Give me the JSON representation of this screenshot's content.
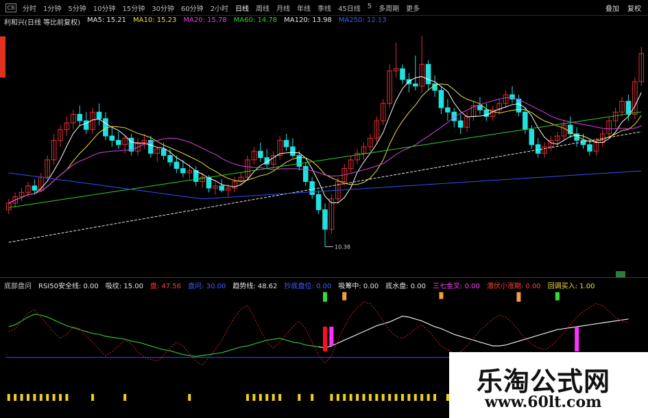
{
  "toolbar": {
    "window_badge": "CB",
    "tabs": [
      "分时",
      "1分钟",
      "5分钟",
      "10分钟",
      "15分钟",
      "30分钟",
      "60分钟",
      "2小时",
      "日线",
      "周线",
      "月线",
      "年线",
      "季线",
      "45日线",
      "5",
      "多周期",
      "更多"
    ],
    "active_tab": "日线",
    "right_buttons": [
      "叠加",
      "复权"
    ]
  },
  "main_legend": {
    "stock": "利和兴(日线 等比前复权)",
    "items": [
      {
        "label": "MA5: 15.21",
        "color": "#e8e8e8"
      },
      {
        "label": "MA10: 15.23",
        "color": "#f0e040"
      },
      {
        "label": "MA20: 15.78",
        "color": "#e040e0"
      },
      {
        "label": "MA60: 14.78",
        "color": "#30d030"
      },
      {
        "label": "MA120: 13.98",
        "color": "#e8e8e8"
      },
      {
        "label": "MA250: 12.13",
        "color": "#3060ff"
      }
    ]
  },
  "low_label": "10.38",
  "ind_legend": {
    "items": [
      {
        "label": "底部盘问",
        "color": "#c8c8c8"
      },
      {
        "label": "RSI50安全线: 0.00",
        "color": "#e8e8e8"
      },
      {
        "label": "吸纹: 15.00",
        "color": "#e8e8e8"
      },
      {
        "label": "盘: 47.56",
        "color": "#ff4040"
      },
      {
        "label": "盘问: 30.00",
        "color": "#4060ff"
      },
      {
        "label": "趋势线: 48.62",
        "color": "#e8e8e8"
      },
      {
        "label": "抄底盘位: 0.00",
        "color": "#4060ff"
      },
      {
        "label": "吸筹中: 0.00",
        "color": "#e8e8e8"
      },
      {
        "label": "底水盘: 0.00",
        "color": "#e8e8e8"
      },
      {
        "label": "三七金叉: 0.00",
        "color": "#ff40ff"
      },
      {
        "label": "潜伏小涨期: 0.00",
        "color": "#ff4040"
      },
      {
        "label": "回调买入: 1.00",
        "color": "#f0e040"
      }
    ]
  },
  "colors": {
    "up": "#e03030",
    "down": "#20e0e0",
    "ma5": "#ffffff",
    "ma10": "#f0e040",
    "ma20": "#e040e0",
    "ma60": "#30d030",
    "ma120": "#e8e8e8",
    "ma250": "#3050ff"
  },
  "chart_data": {
    "type": "candlestick",
    "candles": [
      [
        12.1,
        12.6,
        11.9,
        12.4
      ],
      [
        12.4,
        12.9,
        12.2,
        12.7
      ],
      [
        12.7,
        13.1,
        12.5,
        12.9
      ],
      [
        12.9,
        13.4,
        12.7,
        13.2
      ],
      [
        13.2,
        13.5,
        12.8,
        13.0
      ],
      [
        13.0,
        13.8,
        12.9,
        13.6
      ],
      [
        13.6,
        14.6,
        13.4,
        14.4
      ],
      [
        14.4,
        15.6,
        14.2,
        15.3
      ],
      [
        15.3,
        16.0,
        15.0,
        15.8
      ],
      [
        15.8,
        16.4,
        15.5,
        16.1
      ],
      [
        16.1,
        16.7,
        15.8,
        16.5
      ],
      [
        16.5,
        16.9,
        16.0,
        16.2
      ],
      [
        16.2,
        16.6,
        15.6,
        15.8
      ],
      [
        15.8,
        16.8,
        15.6,
        16.6
      ],
      [
        16.6,
        17.0,
        16.0,
        16.3
      ],
      [
        16.3,
        16.6,
        15.3,
        15.5
      ],
      [
        15.5,
        15.9,
        15.0,
        15.3
      ],
      [
        15.3,
        15.7,
        14.9,
        15.1
      ],
      [
        15.1,
        15.5,
        14.7,
        15.4
      ],
      [
        15.4,
        15.6,
        14.6,
        14.8
      ],
      [
        14.8,
        15.4,
        14.6,
        15.2
      ],
      [
        15.2,
        15.6,
        14.9,
        15.3
      ],
      [
        15.3,
        15.5,
        14.5,
        14.7
      ],
      [
        14.7,
        15.0,
        14.3,
        14.9
      ],
      [
        14.9,
        15.2,
        14.4,
        14.6
      ],
      [
        14.6,
        14.9,
        14.1,
        14.3
      ],
      [
        14.3,
        14.6,
        13.8,
        14.0
      ],
      [
        14.0,
        14.4,
        13.6,
        13.8
      ],
      [
        13.8,
        14.2,
        13.5,
        13.9
      ],
      [
        13.9,
        14.1,
        13.2,
        13.4
      ],
      [
        13.4,
        13.8,
        13.1,
        13.6
      ],
      [
        13.6,
        13.7,
        12.9,
        13.1
      ],
      [
        13.1,
        13.4,
        12.8,
        13.2
      ],
      [
        13.2,
        13.5,
        12.9,
        13.0
      ],
      [
        13.0,
        13.3,
        12.7,
        13.1
      ],
      [
        13.1,
        13.6,
        12.9,
        13.4
      ],
      [
        13.4,
        13.8,
        13.2,
        13.6
      ],
      [
        13.6,
        14.6,
        13.5,
        14.4
      ],
      [
        14.4,
        15.0,
        14.2,
        14.8
      ],
      [
        14.8,
        15.2,
        14.3,
        14.5
      ],
      [
        14.5,
        14.9,
        14.0,
        14.2
      ],
      [
        14.2,
        14.8,
        14.0,
        14.6
      ],
      [
        14.6,
        15.5,
        14.4,
        15.3
      ],
      [
        15.3,
        15.6,
        14.8,
        15.0
      ],
      [
        15.0,
        15.4,
        14.5,
        14.6
      ],
      [
        14.6,
        14.8,
        13.9,
        14.1
      ],
      [
        14.1,
        14.3,
        13.2,
        13.4
      ],
      [
        13.4,
        13.6,
        12.6,
        12.8
      ],
      [
        12.8,
        13.0,
        11.9,
        12.1
      ],
      [
        12.1,
        12.4,
        10.4,
        11.2
      ],
      [
        11.2,
        12.8,
        11.0,
        12.6
      ],
      [
        12.6,
        13.6,
        12.4,
        13.4
      ],
      [
        13.4,
        14.2,
        13.2,
        14.0
      ],
      [
        14.0,
        14.6,
        13.8,
        14.4
      ],
      [
        14.4,
        14.9,
        14.2,
        14.7
      ],
      [
        14.7,
        15.2,
        14.4,
        15.0
      ],
      [
        15.0,
        15.6,
        14.8,
        15.4
      ],
      [
        15.4,
        16.4,
        15.2,
        16.2
      ],
      [
        16.2,
        17.2,
        16.0,
        17.0
      ],
      [
        17.0,
        18.8,
        16.8,
        18.5
      ],
      [
        18.5,
        19.8,
        18.2,
        18.6
      ],
      [
        18.6,
        18.8,
        17.9,
        18.1
      ],
      [
        18.1,
        18.4,
        17.5,
        17.9
      ],
      [
        17.9,
        19.2,
        17.6,
        17.8
      ],
      [
        17.8,
        20.1,
        17.5,
        18.8
      ],
      [
        18.8,
        19.0,
        17.6,
        17.9
      ],
      [
        17.9,
        18.3,
        17.3,
        17.6
      ],
      [
        17.6,
        17.8,
        16.5,
        16.8
      ],
      [
        16.8,
        17.2,
        16.2,
        16.6
      ],
      [
        16.6,
        16.8,
        15.9,
        16.2
      ],
      [
        16.2,
        16.5,
        15.6,
        15.9
      ],
      [
        15.9,
        16.6,
        15.7,
        16.4
      ],
      [
        16.4,
        17.1,
        16.2,
        16.9
      ],
      [
        16.9,
        17.3,
        16.5,
        16.7
      ],
      [
        16.7,
        17.0,
        16.2,
        16.4
      ],
      [
        16.4,
        16.9,
        16.2,
        16.7
      ],
      [
        16.7,
        17.2,
        16.5,
        17.0
      ],
      [
        17.0,
        17.6,
        16.8,
        17.4
      ],
      [
        17.4,
        17.8,
        17.0,
        17.2
      ],
      [
        17.2,
        17.4,
        16.4,
        16.6
      ],
      [
        16.6,
        16.8,
        15.6,
        15.8
      ],
      [
        15.8,
        16.0,
        14.9,
        15.1
      ],
      [
        15.1,
        15.4,
        14.5,
        14.7
      ],
      [
        14.7,
        15.2,
        14.5,
        15.0
      ],
      [
        15.0,
        15.5,
        14.8,
        15.3
      ],
      [
        15.3,
        15.7,
        15.0,
        15.5
      ],
      [
        15.5,
        16.2,
        15.3,
        16.0
      ],
      [
        16.0,
        16.4,
        15.4,
        15.6
      ],
      [
        15.6,
        15.9,
        15.0,
        15.3
      ],
      [
        15.3,
        15.6,
        14.9,
        15.1
      ],
      [
        15.1,
        15.3,
        14.6,
        14.8
      ],
      [
        14.8,
        15.4,
        14.6,
        15.2
      ],
      [
        15.2,
        15.8,
        15.0,
        15.6
      ],
      [
        15.6,
        16.4,
        15.4,
        16.2
      ],
      [
        16.2,
        16.8,
        15.9,
        16.6
      ],
      [
        16.6,
        17.3,
        16.4,
        17.1
      ],
      [
        17.1,
        17.4,
        16.2,
        16.5
      ],
      [
        16.5,
        18.2,
        16.3,
        18.0
      ],
      [
        18.0,
        19.6,
        17.8,
        19.3
      ]
    ],
    "ind_white": [
      60,
      62,
      66,
      70,
      73,
      72,
      70,
      67,
      64,
      61,
      59,
      57,
      55,
      53,
      52,
      50,
      49,
      48,
      47,
      45,
      44,
      42,
      40,
      38,
      36,
      35,
      33,
      31,
      30,
      29,
      30,
      31,
      32,
      33,
      35,
      37,
      39,
      40,
      42,
      44,
      46,
      47,
      48,
      46,
      44,
      43,
      41,
      40,
      39,
      38,
      40,
      43,
      46,
      49,
      52,
      55,
      58,
      61,
      63,
      65,
      68,
      71,
      70,
      68,
      66,
      63,
      60,
      58,
      55,
      52,
      50,
      48,
      46,
      44,
      42,
      40,
      40,
      41,
      43,
      45,
      47,
      49,
      51,
      53,
      55,
      57,
      58,
      59,
      60,
      61,
      62,
      63,
      64,
      65,
      66,
      67,
      68
    ],
    "ind_red": [
      55,
      58,
      66,
      74,
      78,
      70,
      62,
      54,
      48,
      52,
      60,
      58,
      50,
      44,
      36,
      30,
      34,
      40,
      46,
      42,
      34,
      28,
      26,
      24,
      30,
      38,
      44,
      40,
      32,
      24,
      20,
      28,
      36,
      46,
      58,
      70,
      78,
      82,
      70,
      56,
      44,
      38,
      44,
      52,
      60,
      66,
      58,
      44,
      30,
      22,
      30,
      46,
      60,
      72,
      80,
      86,
      84,
      76,
      66,
      56,
      50,
      48,
      52,
      58,
      62,
      56,
      48,
      40,
      36,
      32,
      34,
      40,
      48,
      56,
      62,
      68,
      72,
      70,
      64,
      56,
      48,
      42,
      38,
      36,
      40,
      46,
      54,
      62,
      70,
      76,
      80,
      84,
      82,
      76,
      70,
      66,
      64
    ],
    "ind_green_end": 49,
    "ind_blue_line": 28,
    "signals": [
      {
        "i": 49,
        "color": "#ff1020",
        "h": 36
      },
      {
        "i": 50,
        "color": "#ff30ff",
        "h": 28
      },
      {
        "i": 49,
        "color": "#30e030",
        "h": 14,
        "top": true
      },
      {
        "i": 52,
        "color": "#f0a040",
        "h": 12,
        "top": true
      },
      {
        "i": 67,
        "color": "#f0a040",
        "h": 10,
        "top": true
      },
      {
        "i": 79,
        "color": "#f0a040",
        "h": 14,
        "top": true
      },
      {
        "i": 85,
        "color": "#30e030",
        "h": 12,
        "top": true
      },
      {
        "i": 88,
        "color": "#ff30ff",
        "h": 36
      }
    ],
    "bottom_marks": [
      0,
      1,
      2,
      3,
      4,
      5,
      6,
      7,
      8,
      9,
      13,
      18,
      28,
      37,
      38,
      39,
      40,
      41,
      42,
      45,
      47,
      50,
      51,
      52,
      53,
      54,
      55,
      56,
      57,
      58,
      59,
      60,
      61,
      62,
      63,
      64,
      65,
      66,
      68,
      69,
      70,
      71,
      72,
      73,
      74
    ],
    "price_range": [
      10,
      20.5
    ]
  }
}
